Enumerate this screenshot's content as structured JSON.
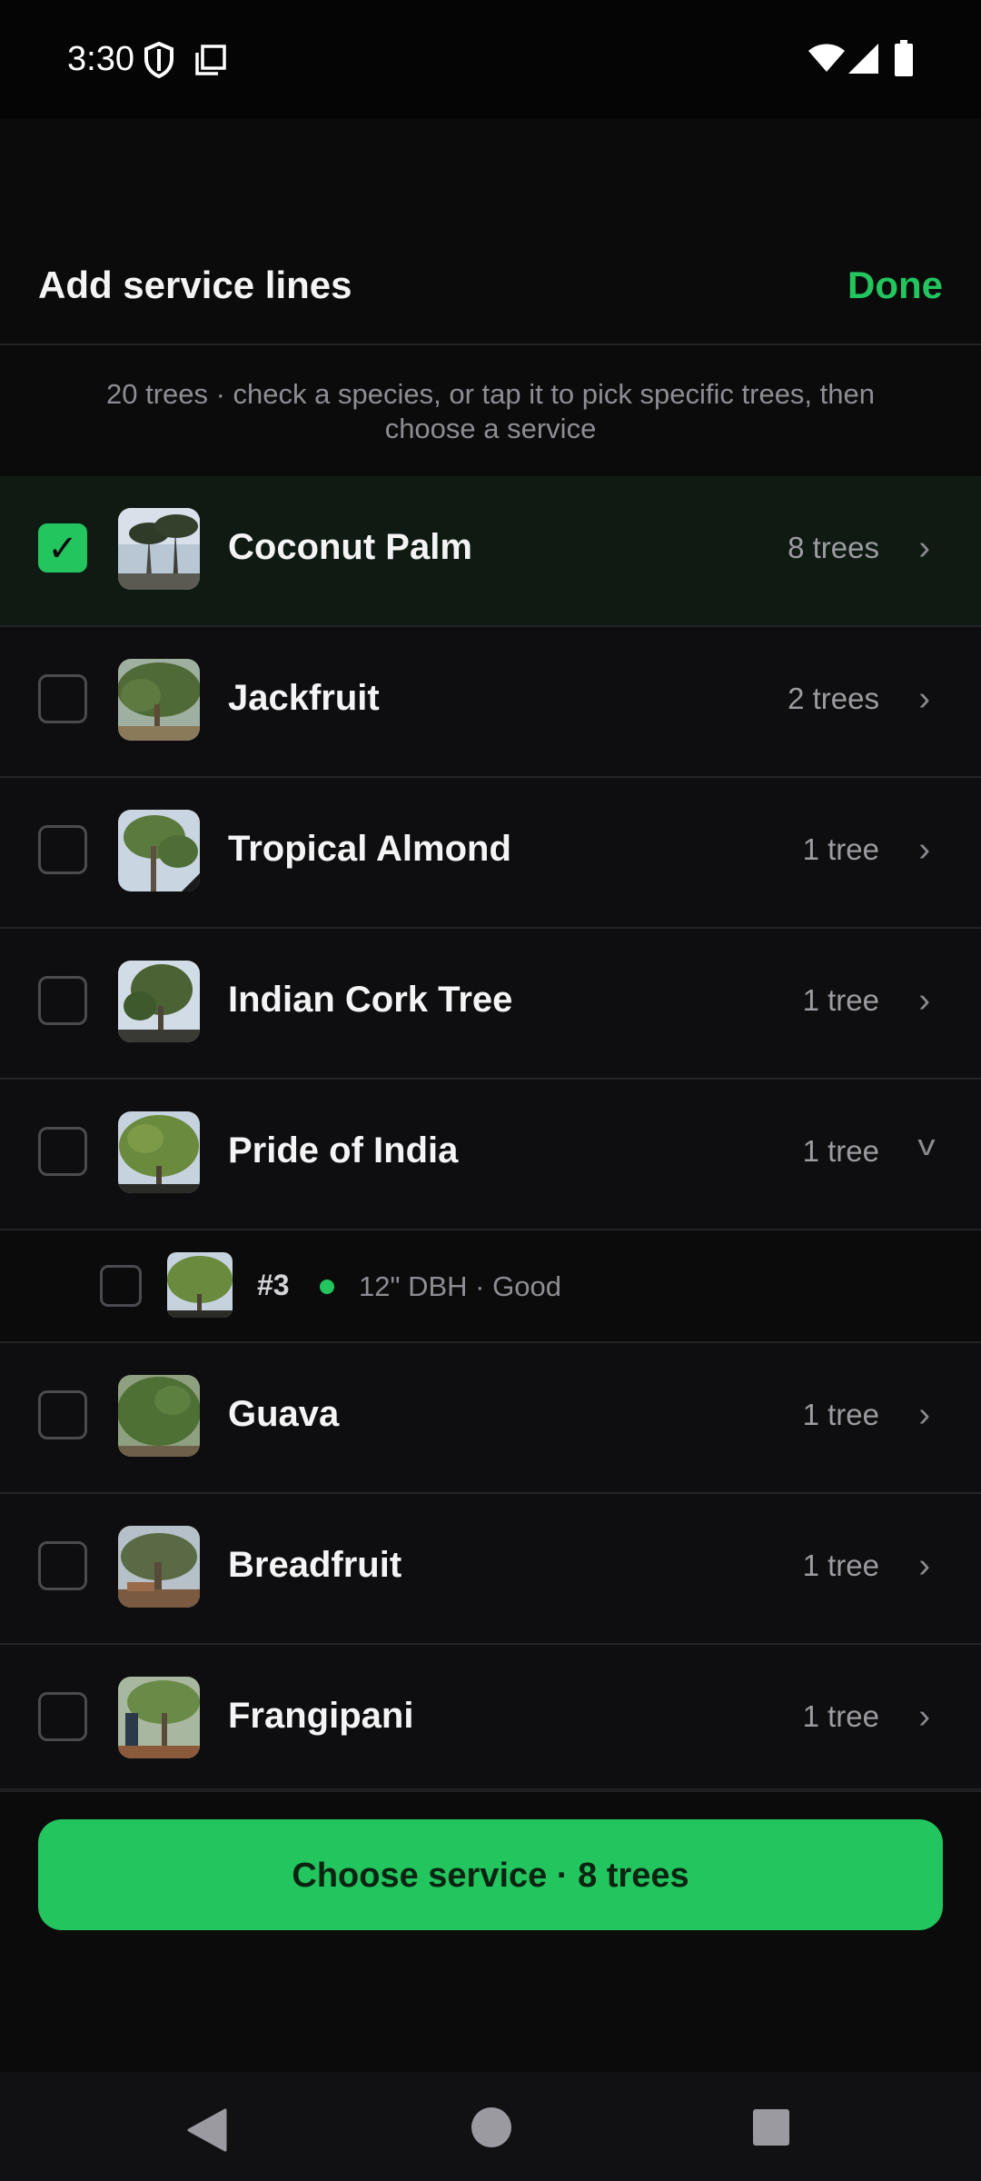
{
  "status_bar": {
    "time": "3:30",
    "icons_left": [
      "shield-icon",
      "screenshot-icon"
    ],
    "icons_right": [
      "wifi-icon",
      "signal-icon",
      "battery-icon"
    ]
  },
  "header": {
    "title": "Add service lines",
    "done_label": "Done",
    "hint": "20 trees · check a species, or tap it to pick specific trees, then choose a service"
  },
  "species": [
    {
      "name": "Coconut Palm",
      "count": "8 trees",
      "checked": true,
      "expanded": false
    },
    {
      "name": "Jackfruit",
      "count": "2 trees",
      "checked": false,
      "expanded": false
    },
    {
      "name": "Tropical Almond",
      "count": "1 tree",
      "checked": false,
      "expanded": false
    },
    {
      "name": "Indian Cork Tree",
      "count": "1 tree",
      "checked": false,
      "expanded": false
    },
    {
      "name": "Pride of India",
      "count": "1 tree",
      "checked": false,
      "expanded": true
    },
    {
      "name": "Guava",
      "count": "1 tree",
      "checked": false,
      "expanded": false
    },
    {
      "name": "Breadfruit",
      "count": "1 tree",
      "checked": false,
      "expanded": false
    },
    {
      "name": "Frangipani",
      "count": "1 tree",
      "checked": false,
      "expanded": false
    }
  ],
  "expanded_tree": {
    "id": "#3",
    "detail": "12\" DBH · Good",
    "status_color": "#22c55e"
  },
  "cta_label": "Choose service · 8 trees",
  "glyphs": {
    "check": "✓",
    "chevron_right": "›",
    "chevron_down": "v"
  },
  "colors": {
    "accent": "#22c55e",
    "background": "#0b0b0c",
    "selected_row": "#0f1a13"
  }
}
